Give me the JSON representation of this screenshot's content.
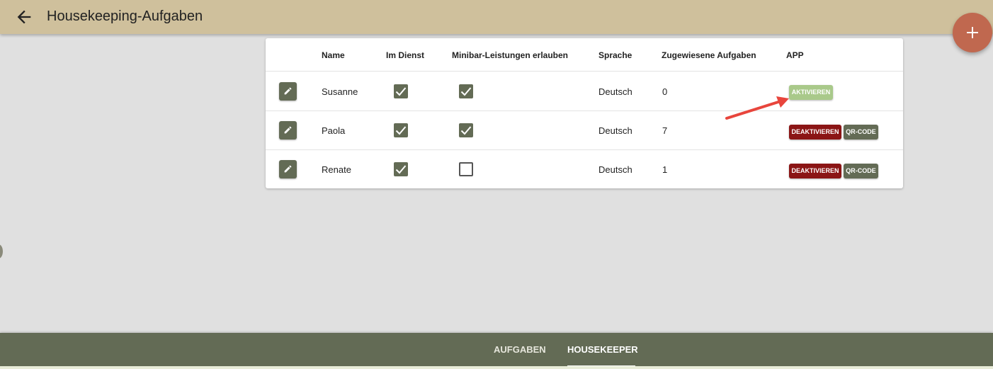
{
  "header": {
    "title": "Housekeeping-Aufgaben",
    "back_icon": "arrow-left-icon",
    "background": "#cfc09c"
  },
  "fab": {
    "icon": "plus-icon",
    "color": "#c0684f"
  },
  "table": {
    "columns": [
      "",
      "Name",
      "Im Dienst",
      "Minibar-Leistungen erlauben",
      "Sprache",
      "Zugewiesene Aufgaben",
      "APP"
    ],
    "rows": [
      {
        "name": "Susanne",
        "im_dienst": true,
        "minibar": true,
        "sprache": "Deutsch",
        "aufgaben": "0",
        "app": {
          "activate": "AKTIVIEREN"
        }
      },
      {
        "name": "Paola",
        "im_dienst": true,
        "minibar": true,
        "sprache": "Deutsch",
        "aufgaben": "7",
        "app": {
          "deactivate": "DEAKTIVIEREN",
          "qr": "QR-CODE"
        }
      },
      {
        "name": "Renate",
        "im_dienst": true,
        "minibar": false,
        "sprache": "Deutsch",
        "aufgaben": "1",
        "app": {
          "deactivate": "DEAKTIVIEREN",
          "qr": "QR-CODE"
        }
      }
    ]
  },
  "annotation": {
    "icon": "red-arrow-icon",
    "color": "#e8453c"
  },
  "bottom_nav": {
    "tabs": [
      {
        "label": "AUFGABEN",
        "active": false
      },
      {
        "label": "HOUSEKEEPER",
        "active": true
      }
    ],
    "background": "#636b55"
  },
  "colors": {
    "accent": "#636b55",
    "activate": "#a9c98a",
    "deactivate": "#8b1515"
  }
}
